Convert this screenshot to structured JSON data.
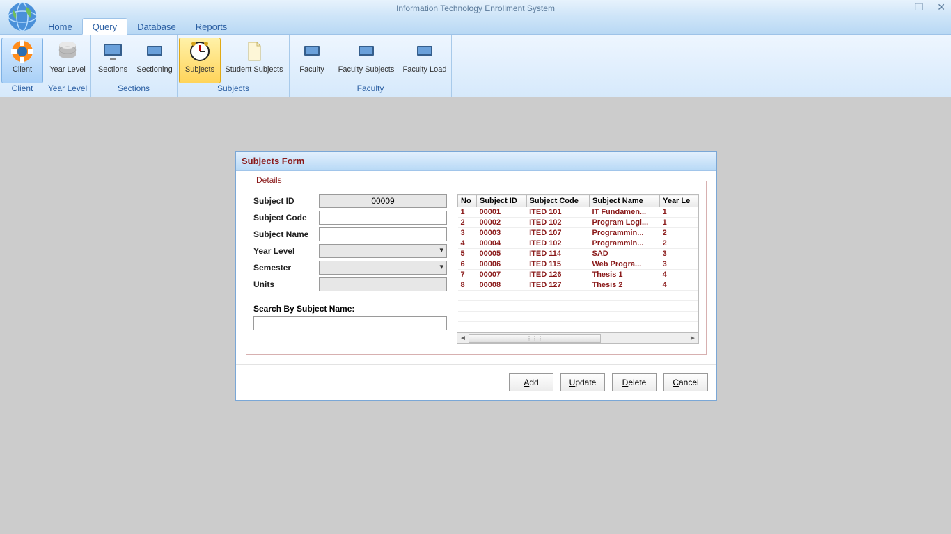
{
  "window": {
    "title": "Information Technology Enrollment System"
  },
  "tabs": {
    "home": "Home",
    "query": "Query",
    "database": "Database",
    "reports": "Reports"
  },
  "ribbon": {
    "client_btn": "Client",
    "client_group": "Client",
    "yearlevel_btn": "Year Level",
    "yearlevel_group": "Year Level",
    "sections_btn": "Sections",
    "sectioning_btn": "Sectioning",
    "sections_group": "Sections",
    "subjects_btn": "Subjects",
    "student_subjects_btn": "Student Subjects",
    "subjects_group": "Subjects",
    "faculty_btn": "Faculty",
    "faculty_subjects_btn": "Faculty Subjects",
    "faculty_load_btn": "Faculty Load",
    "faculty_group": "Faculty"
  },
  "form": {
    "title": "Subjects Form",
    "legend": "Details",
    "labels": {
      "subject_id": "Subject ID",
      "subject_code": "Subject Code",
      "subject_name": "Subject Name",
      "year_level": "Year Level",
      "semester": "Semester",
      "units": "Units",
      "search": "Search By Subject Name:"
    },
    "values": {
      "subject_id": "00009",
      "subject_code": "",
      "subject_name": "",
      "year_level": "",
      "semester": "",
      "units": "",
      "search": ""
    },
    "buttons": {
      "add": "Add",
      "update": "Update",
      "delete": "Delete",
      "cancel": "Cancel"
    }
  },
  "grid": {
    "headers": {
      "no": "No",
      "subject_id": "Subject ID",
      "subject_code": "Subject Code",
      "subject_name": "Subject Name",
      "year_level": "Year Le"
    },
    "rows": [
      {
        "no": "1",
        "id": "00001",
        "code": "ITED 101",
        "name": "IT Fundamen...",
        "yl": "1"
      },
      {
        "no": "2",
        "id": "00002",
        "code": "ITED 102",
        "name": "Program Logi...",
        "yl": "1"
      },
      {
        "no": "3",
        "id": "00003",
        "code": "ITED 107",
        "name": "Programmin...",
        "yl": "2"
      },
      {
        "no": "4",
        "id": "00004",
        "code": "ITED 102",
        "name": "Programmin...",
        "yl": "2"
      },
      {
        "no": "5",
        "id": "00005",
        "code": "ITED 114",
        "name": "SAD",
        "yl": "3"
      },
      {
        "no": "6",
        "id": "00006",
        "code": "ITED 115",
        "name": "Web Progra...",
        "yl": "3"
      },
      {
        "no": "7",
        "id": "00007",
        "code": "ITED 126",
        "name": "Thesis 1",
        "yl": "4"
      },
      {
        "no": "8",
        "id": "00008",
        "code": "ITED 127",
        "name": "Thesis 2",
        "yl": "4"
      }
    ]
  }
}
